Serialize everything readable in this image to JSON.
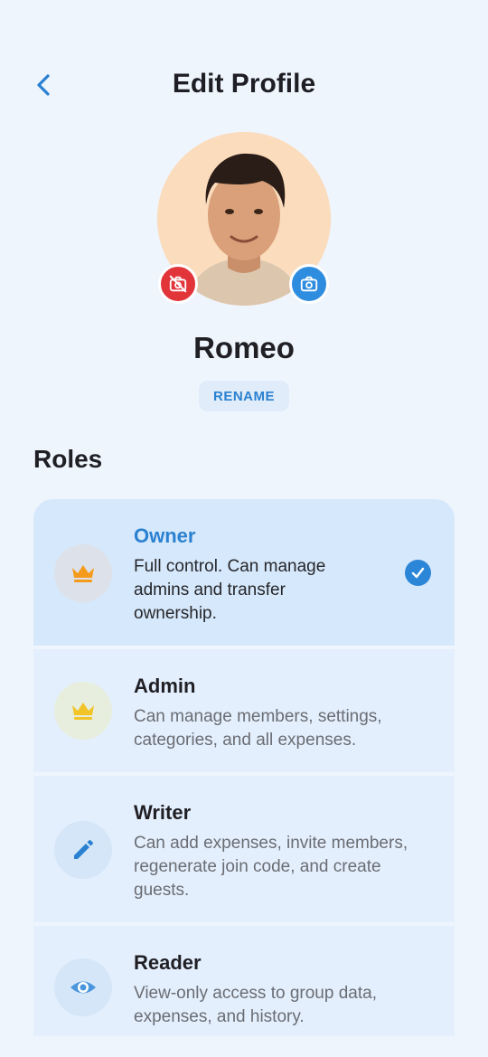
{
  "header": {
    "title": "Edit Profile"
  },
  "profile": {
    "name": "Romeo",
    "rename_label": "RENAME"
  },
  "roles": {
    "title": "Roles",
    "items": [
      {
        "name": "Owner",
        "description": "Full control. Can manage admins and transfer ownership.",
        "icon": "crown-icon",
        "selected": true
      },
      {
        "name": "Admin",
        "description": "Can manage members, settings, categories, and all expenses.",
        "icon": "crown-icon",
        "selected": false
      },
      {
        "name": "Writer",
        "description": "Can add expenses, invite members, regenerate join code, and create guests.",
        "icon": "pencil-icon",
        "selected": false
      },
      {
        "name": "Reader",
        "description": "View-only access to group data, expenses, and history.",
        "icon": "eye-icon",
        "selected": false
      }
    ]
  },
  "colors": {
    "accent": "#2a81d1",
    "background": "#eef5fd",
    "danger": "#e1353a",
    "crown_owner": "#f59b1c",
    "crown_admin": "#f2c427"
  }
}
